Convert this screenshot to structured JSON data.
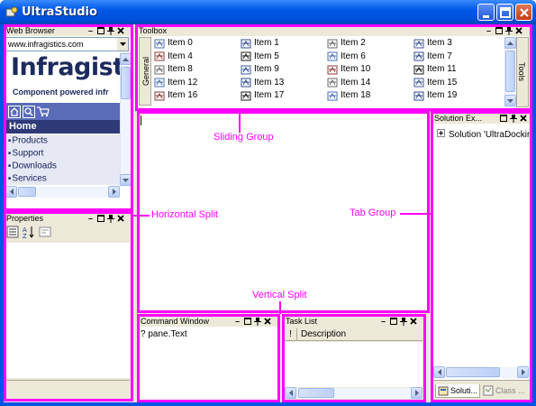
{
  "window": {
    "title": "UltraStudio"
  },
  "web_browser": {
    "title": "Web Browser",
    "address": "www.infragistics.com",
    "logo_text": "Infragist",
    "tagline": "Component powered infr",
    "section": "Home",
    "links": [
      "Products",
      "Support",
      "Downloads",
      "Services"
    ]
  },
  "properties": {
    "title": "Properties"
  },
  "toolbox": {
    "title": "Toolbox",
    "tab_left": "General",
    "tab_right": "Tools",
    "items": [
      "Item 0",
      "Item 1",
      "Item 2",
      "Item 3",
      "Item 4",
      "Item 5",
      "Item 6",
      "Item 7",
      "Item 8",
      "Item 9",
      "Item 10",
      "Item 11",
      "Item 12",
      "Item 13",
      "Item 14",
      "Item 15",
      "Item 16",
      "Item 17",
      "Item 18",
      "Item 19"
    ]
  },
  "solution": {
    "title": "Solution Ex...",
    "tree_item": "Solution 'UltraDocking",
    "tab1": "Soluti...",
    "tab2": "Class ..."
  },
  "command_window": {
    "title": "Command Window",
    "text": "? pane.Text"
  },
  "task_list": {
    "title": "Task List",
    "col_flag": "!",
    "col_desc": "Description"
  },
  "annotations": {
    "sliding": "Sliding Group",
    "horizontal": "Horizontal Split",
    "tab": "Tab Group",
    "vertical": "Vertical Split"
  },
  "colors": {
    "annotation": "#ff00ff",
    "titlebar": "#0054e3"
  }
}
